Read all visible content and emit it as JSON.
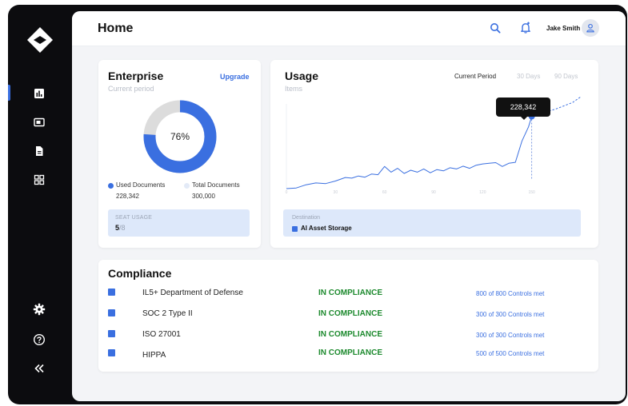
{
  "app": {
    "page_title": "Home",
    "user_name": "Jake Smith",
    "accent_color": "#3a6fe0",
    "sidebar": {
      "nav_items": [
        {
          "icon": "bar-chart-icon",
          "active": true
        },
        {
          "icon": "image-icon",
          "active": false
        },
        {
          "icon": "document-icon",
          "active": false
        },
        {
          "icon": "grid-icon",
          "active": false
        }
      ],
      "bottom_items": [
        {
          "icon": "gear-icon"
        },
        {
          "icon": "help-icon"
        },
        {
          "icon": "collapse-icon"
        }
      ]
    },
    "header_icons": [
      "search-icon",
      "bell-icon",
      "user-icon"
    ]
  },
  "enterprise": {
    "title": "Enterprise",
    "subtitle": "Current period",
    "upgrade_label": "Upgrade",
    "donut_percent_label": "76%",
    "donut_fraction": 0.76,
    "used_label": "Used Documents",
    "used_value": "228,342",
    "total_label": "Total Documents",
    "total_value": "300,000",
    "seat_label": "SEAT USAGE",
    "seat_used": "5",
    "seat_total": "/8"
  },
  "usage": {
    "title": "Usage",
    "subtitle": "Items",
    "periods": [
      "Current Period",
      "30 Days",
      "90 Days"
    ],
    "active_period": "Current Period",
    "tooltip_value": "228,342",
    "destination_label": "Destination",
    "destination_value": "AI Asset Storage"
  },
  "chart_data": {
    "type": "line",
    "x_ticks": [
      "0",
      "30",
      "60",
      "90",
      "120",
      "150"
    ],
    "xlim": [
      0,
      180
    ],
    "ylim": [
      0,
      260000
    ],
    "series": [
      {
        "style": "solid",
        "x": [
          0,
          6,
          12,
          18,
          24,
          30,
          36,
          40,
          44,
          48,
          52,
          56,
          60,
          64,
          68,
          72,
          76,
          80,
          84,
          88,
          92,
          96,
          100,
          104,
          108,
          112,
          116,
          120,
          124,
          128,
          132,
          136,
          140,
          144,
          148,
          150
        ],
        "y": [
          0,
          2000,
          12000,
          18000,
          16000,
          24000,
          35000,
          33000,
          40000,
          36000,
          46000,
          44000,
          70000,
          52000,
          64000,
          48000,
          58000,
          52000,
          62000,
          50000,
          60000,
          56000,
          66000,
          62000,
          71000,
          64000,
          74000,
          78000,
          80000,
          82000,
          70000,
          80000,
          83000,
          150000,
          195000,
          228342
        ]
      },
      {
        "style": "dashed",
        "x": [
          150,
          155,
          160,
          165,
          170,
          175,
          180
        ],
        "y": [
          228342,
          236000,
          244000,
          252000,
          262000,
          272000,
          290000
        ]
      }
    ],
    "highlight_point": {
      "x": 150,
      "y": 228342
    }
  },
  "compliance": {
    "title": "Compliance",
    "rows": [
      {
        "name": "IL5+ Department of Defense",
        "status": "IN COMPLIANCE",
        "controls": "800 of 800 Controls met"
      },
      {
        "name": "SOC 2 Type II",
        "status": "IN COMPLIANCE",
        "controls": "300 of 300 Controls met"
      },
      {
        "name": "ISO 27001",
        "status": "IN COMPLIANCE",
        "controls": "300 of 300 Controls met"
      },
      {
        "name": "HIPPA",
        "status": "IN COMPLIANCE",
        "controls": "500 of 500 Controls met"
      }
    ]
  }
}
